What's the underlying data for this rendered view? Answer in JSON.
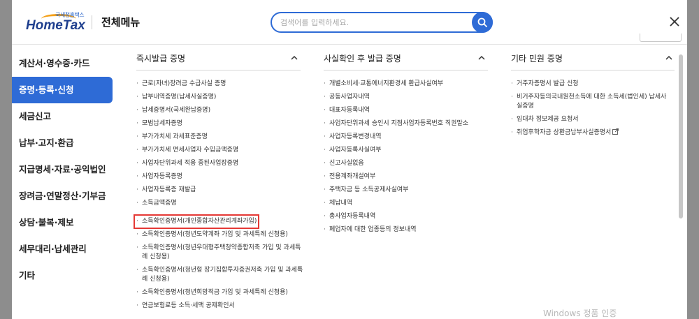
{
  "header": {
    "logo_small": "국세청홈택스",
    "logo_main": "HomeTax",
    "title": "전체메뉴",
    "search_placeholder": "검색어를 입력하세요."
  },
  "sidebar": {
    "items": [
      {
        "label": "계산서·영수증·카드",
        "active": false
      },
      {
        "label": "증명·등록·신청",
        "active": true
      },
      {
        "label": "세금신고",
        "active": false
      },
      {
        "label": "납부·고지·환급",
        "active": false
      },
      {
        "label": "지급명세·자료·공익법인",
        "active": false
      },
      {
        "label": "장려금·연말정산·기부금",
        "active": false
      },
      {
        "label": "상담·불복·제보",
        "active": false
      },
      {
        "label": "세무대리·납세관리",
        "active": false
      },
      {
        "label": "기타",
        "active": false
      }
    ]
  },
  "columns": [
    {
      "title": "즉시발급 증명",
      "items": [
        "근로(자녀)장려금 수급사실 증명",
        "납부내역증명(납세사실증명)",
        "납세증명서(국세완납증명)",
        "모범납세자증명",
        "부가가치세 과세표준증명",
        "부가가치세 면세사업자 수입금액증명",
        "사업자단위과세 적용 종된사업장증명",
        "사업자등록증명",
        "사업자등록증 재발급",
        "소득금액증명",
        "소득확인증명서(개인종합자산관리계좌가입)",
        "소득확인증명서(청년도약계좌 가입 및 과세특례 신청용)",
        "소득확인증명서(청년우대형주택청약종합저축 가입 및 과세특례 신청용)",
        "소득확인증명서(청년형 장기집합투자증권저축 가입 및 과세특례 신청용)",
        "소득확인증명서(청년희망적금 가입 및 과세특례 신청용)",
        "연금보험료등 소득·세액 공제확인서"
      ],
      "highlight_index": 10
    },
    {
      "title": "사실확인 후 발급 증명",
      "items": [
        "개별소비세·교통에너지환경세 환급사실여부",
        "공동사업자내역",
        "대표자등록내역",
        "사업자단위과세 승인시 지점사업자등록번호 직권말소",
        "사업자등록변경내역",
        "사업자등록사실여부",
        "신고사실없음",
        "전용계좌개설여부",
        "주택자금 등 소득공제사실여부",
        "체납내역",
        "총사업자등록내역",
        "폐업자에 대한 업종등의 정보내역"
      ]
    },
    {
      "title": "기타 민원 증명",
      "items": [
        "거주자증명서 발급 신청",
        "비거주자등의국내원천소득에 대한 소득세(법인세) 납세사실증명",
        "임대차 정보제공 요청서",
        "취업후학자금 상환금납부사실증명서"
      ]
    }
  ],
  "watermark": "Windows 정품 인증",
  "colors": {
    "accent": "#2e6bd6",
    "highlight_box": "#e53935",
    "logo_orange": "#f4a11b",
    "logo_navy": "#1f3f8e"
  }
}
